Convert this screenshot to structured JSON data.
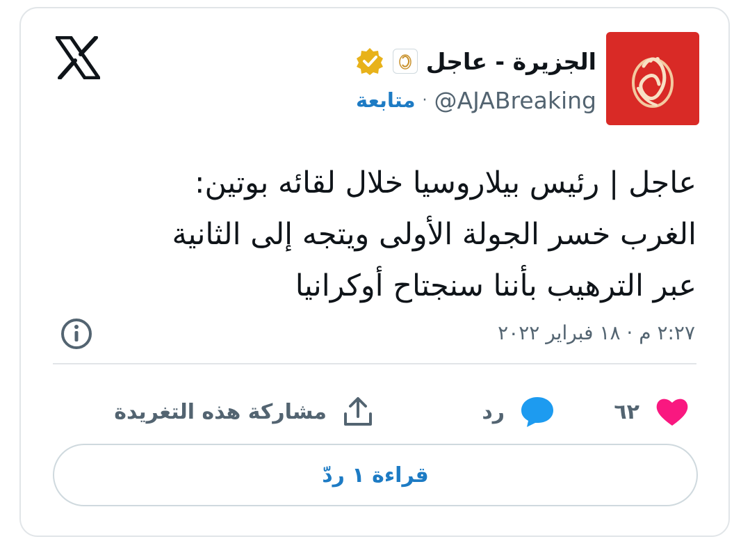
{
  "author": {
    "display_name": "الجزيرة - عاجل",
    "handle": "@AJABreaking",
    "separator": "·",
    "follow_label": "متابعة",
    "avatar_color": "#d92a26",
    "verified_color": "#e8b21a"
  },
  "tweet": {
    "text": "عاجل | رئيس بيلاروسيا خلال لقائه بوتين:\nالغرب خسر الجولة الأولى ويتجه إلى الثانية\nعبر الترهيب بأننا سنجتاح أوكرانيا",
    "timestamp": "٢:٢٧ م · ١٨ فبراير ٢٠٢٢"
  },
  "actions": {
    "like_count": "٦٢",
    "reply_label": "رد",
    "share_label": "مشاركة هذه التغريدة"
  },
  "read_replies_label": "قراءة ١ ردّ",
  "icons": [
    "x-logo-icon",
    "verified-badge-icon",
    "aljazeera-logo-icon",
    "info-icon",
    "heart-icon",
    "reply-bubble-icon",
    "share-icon"
  ],
  "colors": {
    "link": "#1d7bc4",
    "like": "#f91880",
    "reply": "#1d9bf0",
    "muted": "#536471"
  }
}
